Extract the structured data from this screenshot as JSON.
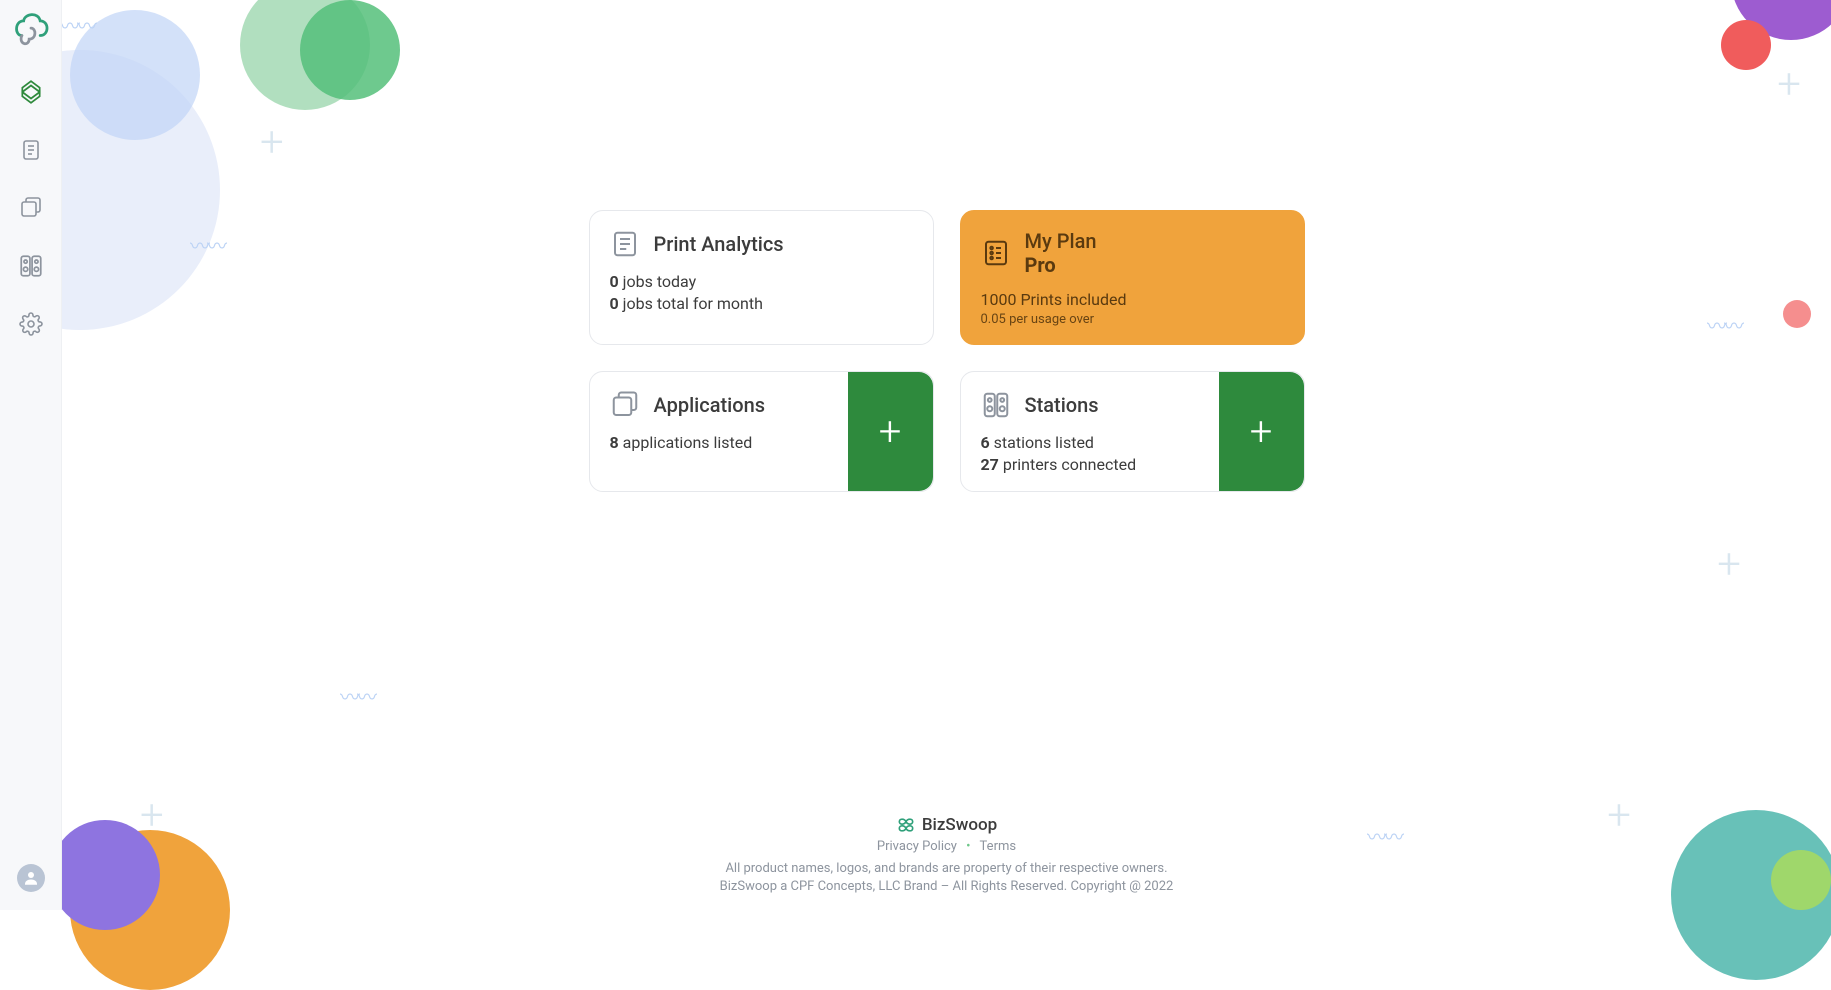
{
  "sidebar": {
    "items": [
      {
        "name": "dashboard",
        "active": true
      },
      {
        "name": "documents"
      },
      {
        "name": "applications"
      },
      {
        "name": "stations"
      },
      {
        "name": "settings"
      }
    ]
  },
  "cards": {
    "analytics": {
      "title": "Print Analytics",
      "jobs_today_count": "0",
      "jobs_today_label": "jobs today",
      "jobs_month_count": "0",
      "jobs_month_label": "jobs total for month"
    },
    "plan": {
      "title": "My Plan",
      "name": "Pro",
      "included": "1000 Prints included",
      "overage": "0.05 per usage over"
    },
    "applications": {
      "title": "Applications",
      "count": "8",
      "count_label": "applications listed"
    },
    "stations": {
      "title": "Stations",
      "stations_count": "6",
      "stations_label": "stations listed",
      "printers_count": "27",
      "printers_label": "printers connected"
    }
  },
  "footer": {
    "brand": "BizSwoop",
    "privacy": "Privacy Policy",
    "terms": "Terms",
    "legal1": "All product names, logos, and brands are property of their respective owners.",
    "legal2": "BizSwoop a CPF Concepts, LLC Brand – All Rights Reserved. Copyright @ 2022"
  }
}
